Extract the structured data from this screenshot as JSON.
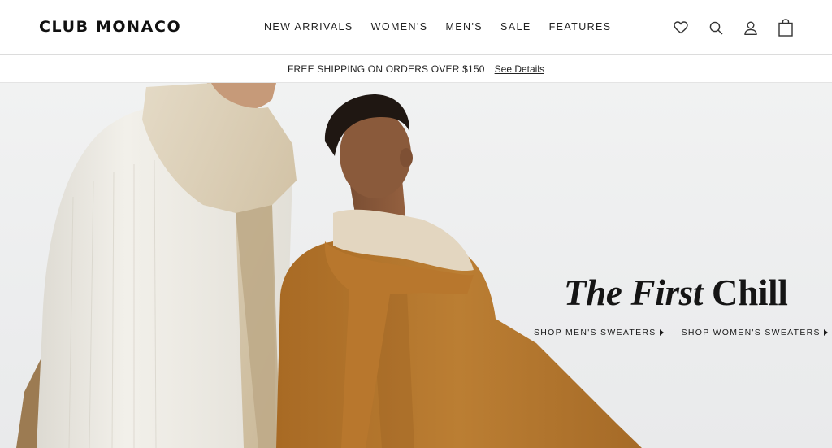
{
  "header": {
    "logo": "CLUB MONACO",
    "nav": [
      {
        "label": "NEW ARRIVALS"
      },
      {
        "label": "WOMEN'S"
      },
      {
        "label": "MEN'S"
      },
      {
        "label": "SALE"
      },
      {
        "label": "FEATURES"
      }
    ],
    "icons": [
      "heart-icon",
      "search-icon",
      "user-icon",
      "shopping-bag-icon"
    ]
  },
  "promo": {
    "text": "FREE SHIPPING ON ORDERS OVER $150",
    "link": "See Details"
  },
  "hero": {
    "title_italic": "The First",
    "title_regular": "Chill",
    "links": [
      {
        "label": "SHOP MEN'S SWEATERS"
      },
      {
        "label": "SHOP WOMEN'S SWEATERS"
      }
    ]
  },
  "colors": {
    "background": "#ffffff",
    "hero_background": "#eceded",
    "text": "#1a1a1a",
    "camel_sweater": "#b7782e",
    "cream_sweater": "#eeece6",
    "scarf_beige": "#d9ccb3"
  }
}
